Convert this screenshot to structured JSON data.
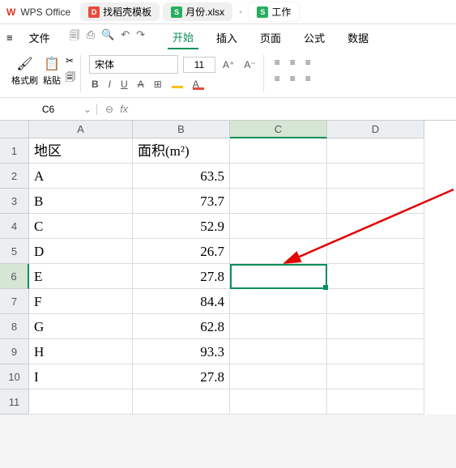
{
  "titlebar": {
    "brand": "WPS Office",
    "tabs": [
      {
        "icon": "D",
        "label": "找稻壳模板",
        "color": "red"
      },
      {
        "icon": "S",
        "label": "月份.xlsx",
        "color": "green"
      },
      {
        "icon": "S",
        "label": "工作",
        "color": "green",
        "active": true
      }
    ]
  },
  "menubar": {
    "file": "文件",
    "tabs": [
      "开始",
      "插入",
      "页面",
      "公式",
      "数据"
    ]
  },
  "ribbon": {
    "format_painter": "格式刷",
    "paste": "粘贴",
    "font_name": "宋体",
    "font_size": "11",
    "bold": "B",
    "italic": "I",
    "underline": "U",
    "strike": "A",
    "font_inc": "A⁺",
    "font_dec": "A⁻"
  },
  "namebox": "C6",
  "fx_label": "fx",
  "columns": [
    "A",
    "B",
    "C",
    "D"
  ],
  "rows": [
    {
      "n": "1",
      "a": "地区",
      "b": "面积(m²)"
    },
    {
      "n": "2",
      "a": "A",
      "b": "63.5"
    },
    {
      "n": "3",
      "a": "B",
      "b": "73.7"
    },
    {
      "n": "4",
      "a": "C",
      "b": "52.9"
    },
    {
      "n": "5",
      "a": "D",
      "b": "26.7"
    },
    {
      "n": "6",
      "a": "E",
      "b": "27.8"
    },
    {
      "n": "7",
      "a": "F",
      "b": "84.4"
    },
    {
      "n": "8",
      "a": "G",
      "b": "62.8"
    },
    {
      "n": "9",
      "a": "H",
      "b": "93.3"
    },
    {
      "n": "10",
      "a": "I",
      "b": "27.8"
    },
    {
      "n": "11",
      "a": "",
      "b": ""
    }
  ]
}
